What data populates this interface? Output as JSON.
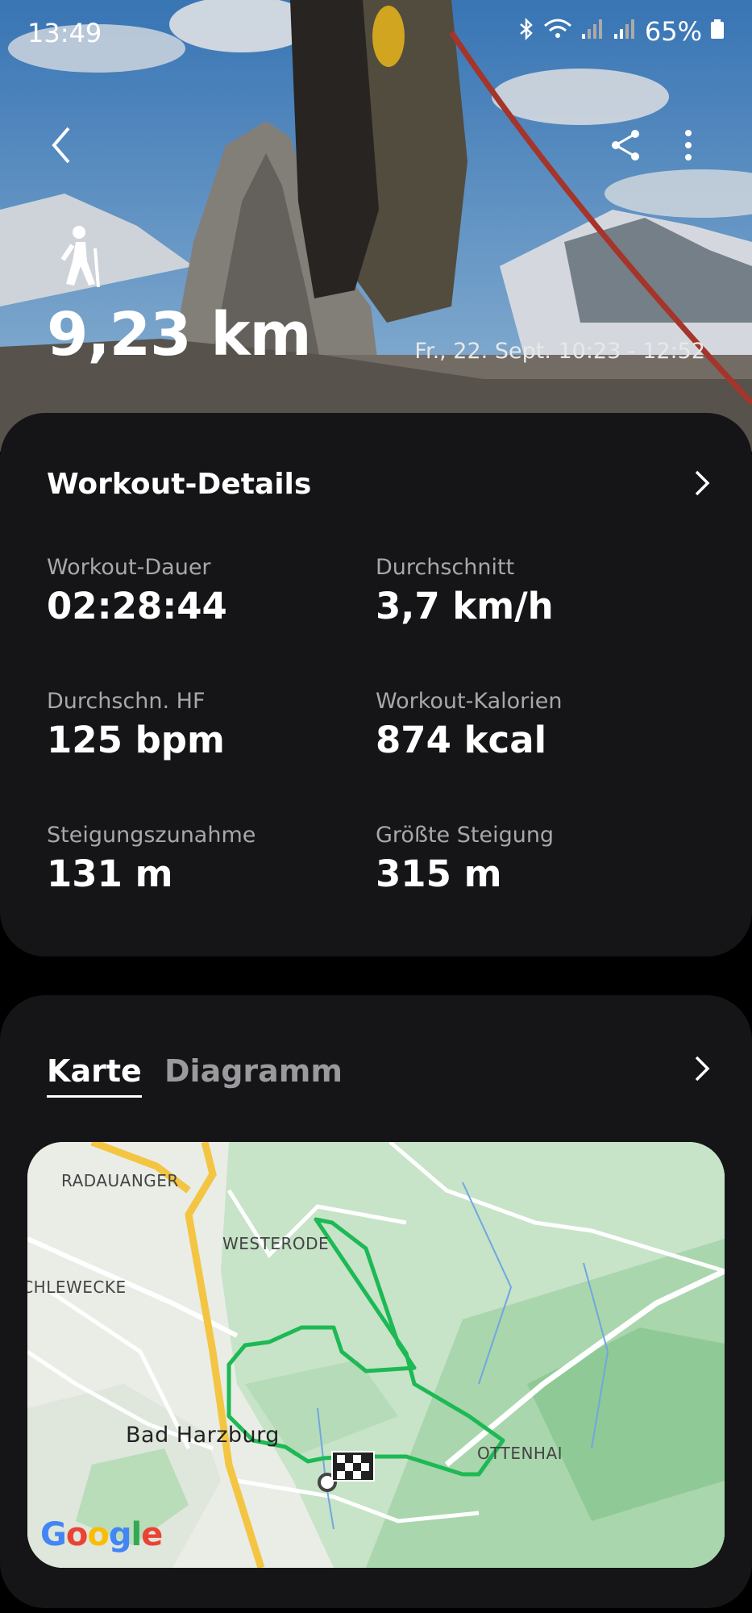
{
  "status_bar": {
    "time": "13:49",
    "battery": "65%"
  },
  "header": {
    "activity_icon": "hiking-icon",
    "distance": "9,23 km",
    "datetime": "Fr., 22. Sept. 10:23 - 12:52"
  },
  "workout_details": {
    "title": "Workout-Details",
    "metrics": [
      {
        "label": "Workout-Dauer",
        "value": "02:28:44"
      },
      {
        "label": "Durchschnitt",
        "value": "3,7 km/h"
      },
      {
        "label": "Durchschn. HF",
        "value": "125 bpm"
      },
      {
        "label": "Workout-Kalorien",
        "value": "874 kcal"
      },
      {
        "label": "Steigungszunahme",
        "value": "131 m"
      },
      {
        "label": "Größte Steigung",
        "value": "315 m"
      }
    ]
  },
  "map_section": {
    "tabs": [
      "Karte",
      "Diagramm"
    ],
    "active_tab": "Karte",
    "labels": {
      "radauanger": "RADAUANGER",
      "westerode": "WESTERODE",
      "schlewecke": "SCHLEWECKE",
      "bad_harzburg": "Bad Harzburg",
      "ottenhai": "OTTENHAI"
    },
    "attribution": "Google",
    "colors": {
      "route": "#1db954",
      "highway": "#f4c542"
    }
  }
}
